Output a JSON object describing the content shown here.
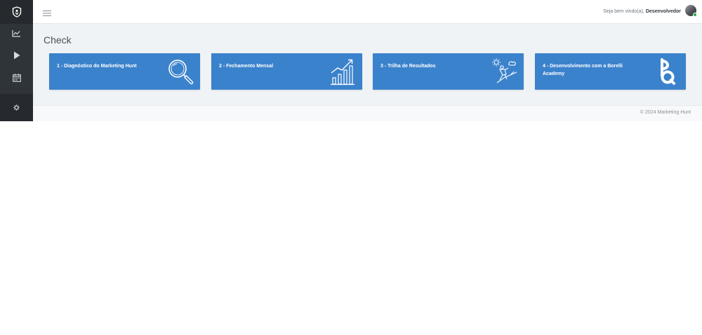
{
  "sidebar": {
    "items": [
      {
        "icon": "chart-line-icon"
      },
      {
        "icon": "play-icon"
      },
      {
        "icon": "calendar-icon"
      }
    ],
    "settings_icon": "gear-icon",
    "logo_icon": "shield-logo-icon"
  },
  "topbar": {
    "welcome_text": "Seja bem vindo(a), ",
    "user_name": "Desenvolvedor"
  },
  "page": {
    "title": "Check"
  },
  "cards": [
    {
      "label": "1 - Diagnóstico do Marketing Hunt",
      "icon": "magnifier-icon"
    },
    {
      "label": "2 - Fechamento Mensal",
      "icon": "growth-chart-icon"
    },
    {
      "label": "3 - Trilha de Resultados",
      "icon": "climber-icon"
    },
    {
      "label": "4 - Desenvolvimento com a Borelli Academy",
      "icon": "borelli-logo-icon"
    }
  ],
  "footer": {
    "copyright": "© 2024 Marketing Hunt"
  },
  "colors": {
    "card": "#3b82cc",
    "sidebar": "#2f3439",
    "content_bg": "#f0f3f5"
  }
}
